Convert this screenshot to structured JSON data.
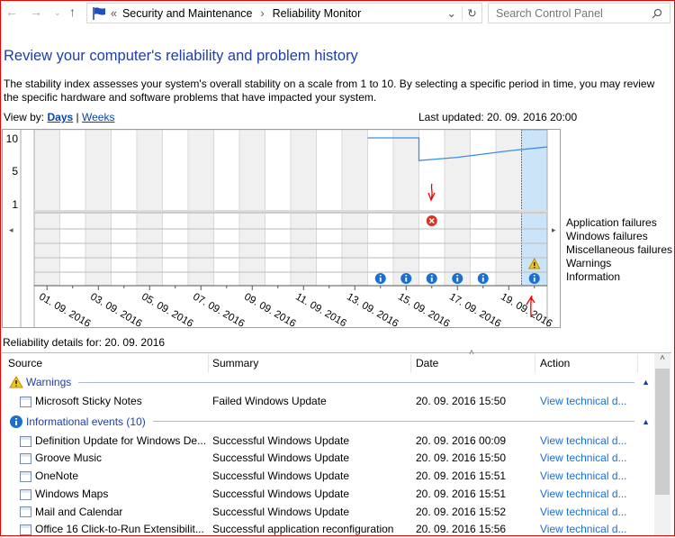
{
  "toolbar": {
    "breadcrumb_prefix": "«",
    "breadcrumb": [
      "Security and Maintenance",
      "Reliability Monitor"
    ],
    "search_placeholder": "Search Control Panel"
  },
  "page": {
    "title": "Review your computer's reliability and problem history",
    "description": "The stability index assesses your system's overall stability on a scale from 1 to 10. By selecting a specific period in time, you may review the specific hardware and software problems that have impacted your system.",
    "view_by_label": "View by:",
    "view_days": "Days",
    "view_sep": "|",
    "view_weeks": "Weeks",
    "last_updated": "Last updated: 20. 09. 2016 20:00"
  },
  "chart_data": {
    "type": "line",
    "title": "",
    "x": [
      "01.09.2016",
      "02.09.2016",
      "03.09.2016",
      "04.09.2016",
      "05.09.2016",
      "06.09.2016",
      "07.09.2016",
      "08.09.2016",
      "09.09.2016",
      "10.09.2016",
      "11.09.2016",
      "12.09.2016",
      "13.09.2016",
      "14.09.2016",
      "15.09.2016",
      "16.09.2016",
      "17.09.2016",
      "18.09.2016",
      "19.09.2016",
      "20.09.2016"
    ],
    "tick_labels": [
      "01. 09. 2016",
      "03. 09. 2016",
      "05. 09. 2016",
      "07. 09. 2016",
      "09. 09. 2016",
      "11. 09. 2016",
      "13. 09. 2016",
      "15. 09. 2016",
      "17. 09. 2016",
      "19. 09. 2016"
    ],
    "y_ticks": [
      "10",
      "5",
      "1"
    ],
    "ylim": [
      1,
      10
    ],
    "stability": [
      null,
      null,
      null,
      null,
      null,
      null,
      null,
      null,
      null,
      null,
      null,
      null,
      null,
      10,
      10,
      6.5,
      7.0,
      7.5,
      8.0,
      8.6
    ],
    "selected": "20.09.2016",
    "rows": [
      "Application failures",
      "Windows failures",
      "Miscellaneous failures",
      "Warnings",
      "Information"
    ],
    "events": {
      "Application failures": [
        "16.09.2016"
      ],
      "Windows failures": [],
      "Miscellaneous failures": [],
      "Warnings": [
        "20.09.2016"
      ],
      "Information": [
        "14.09.2016",
        "15.09.2016",
        "16.09.2016",
        "17.09.2016",
        "18.09.2016",
        "20.09.2016"
      ]
    },
    "line_color": "#3c8ee6",
    "selected_color": "#cce4f7"
  },
  "details": {
    "label": "Reliability details for: 20. 09. 2016",
    "columns": [
      "Source",
      "Summary",
      "Date",
      "Action"
    ],
    "groups": [
      {
        "title": "Warnings",
        "rows": [
          {
            "source": "Microsoft Sticky Notes",
            "summary": "Failed Windows Update",
            "date": "20. 09. 2016 15:50",
            "action": "View  technical d..."
          }
        ]
      },
      {
        "title": "Informational events (10)",
        "rows": [
          {
            "source": "Definition Update for Windows De...",
            "summary": "Successful Windows Update",
            "date": "20. 09. 2016 00:09",
            "action": "View  technical d..."
          },
          {
            "source": "Groove Music",
            "summary": "Successful Windows Update",
            "date": "20. 09. 2016 15:50",
            "action": "View  technical d..."
          },
          {
            "source": "OneNote",
            "summary": "Successful Windows Update",
            "date": "20. 09. 2016 15:51",
            "action": "View  technical d..."
          },
          {
            "source": "Windows Maps",
            "summary": "Successful Windows Update",
            "date": "20. 09. 2016 15:51",
            "action": "View  technical d..."
          },
          {
            "source": "Mail and Calendar",
            "summary": "Successful Windows Update",
            "date": "20. 09. 2016 15:52",
            "action": "View  technical d..."
          },
          {
            "source": "Office 16 Click-to-Run Extensibilit...",
            "summary": "Successful application reconfiguration",
            "date": "20. 09. 2016 15:56",
            "action": "View  technical d..."
          }
        ]
      }
    ]
  }
}
